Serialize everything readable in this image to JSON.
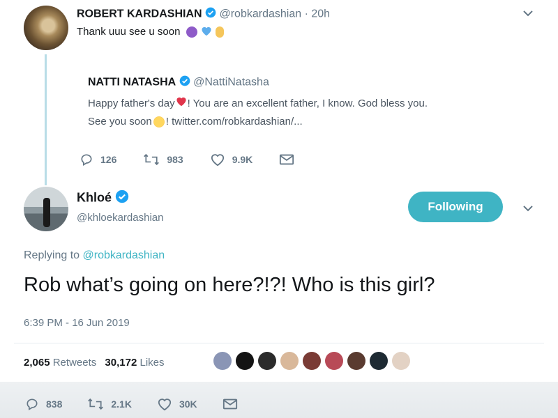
{
  "quoted_reply": {
    "author_name": "ROBERT KARDASHIAN",
    "author_handle": "@robkardashian",
    "time": "· 20h",
    "text": "Thank uuu see u soon"
  },
  "quoted_tweet": {
    "author_name": "NATTI NATASHA",
    "author_handle": "@NattiNatasha",
    "line1_a": "Happy father's day",
    "line1_b": "! You are an excellent father, I know. God bless you.",
    "line2_a": "See you soon",
    "line2_b": "! twitter.com/robkardashian/..."
  },
  "quoted_actions": {
    "replies": "126",
    "retweets": "983",
    "likes": "9.9K"
  },
  "main_tweet": {
    "author_name": "Khloé",
    "author_handle": "@khloekardashian",
    "follow_label": "Following",
    "replying_prefix": "Replying to",
    "replying_to": "@robkardashian",
    "text": "Rob what’s going on here?!?! Who is this girl?",
    "timestamp": "6:39 PM - 16 Jun 2019",
    "retweets_count": "2,065",
    "retweets_label": "Retweets",
    "likes_count": "30,172",
    "likes_label": "Likes"
  },
  "main_actions": {
    "replies": "838",
    "retweets": "2.1K",
    "likes": "30K"
  },
  "colors": {
    "accent": "#3fb4c4",
    "verified": "#1da1f2",
    "text": "#14171a",
    "muted": "#657786"
  }
}
